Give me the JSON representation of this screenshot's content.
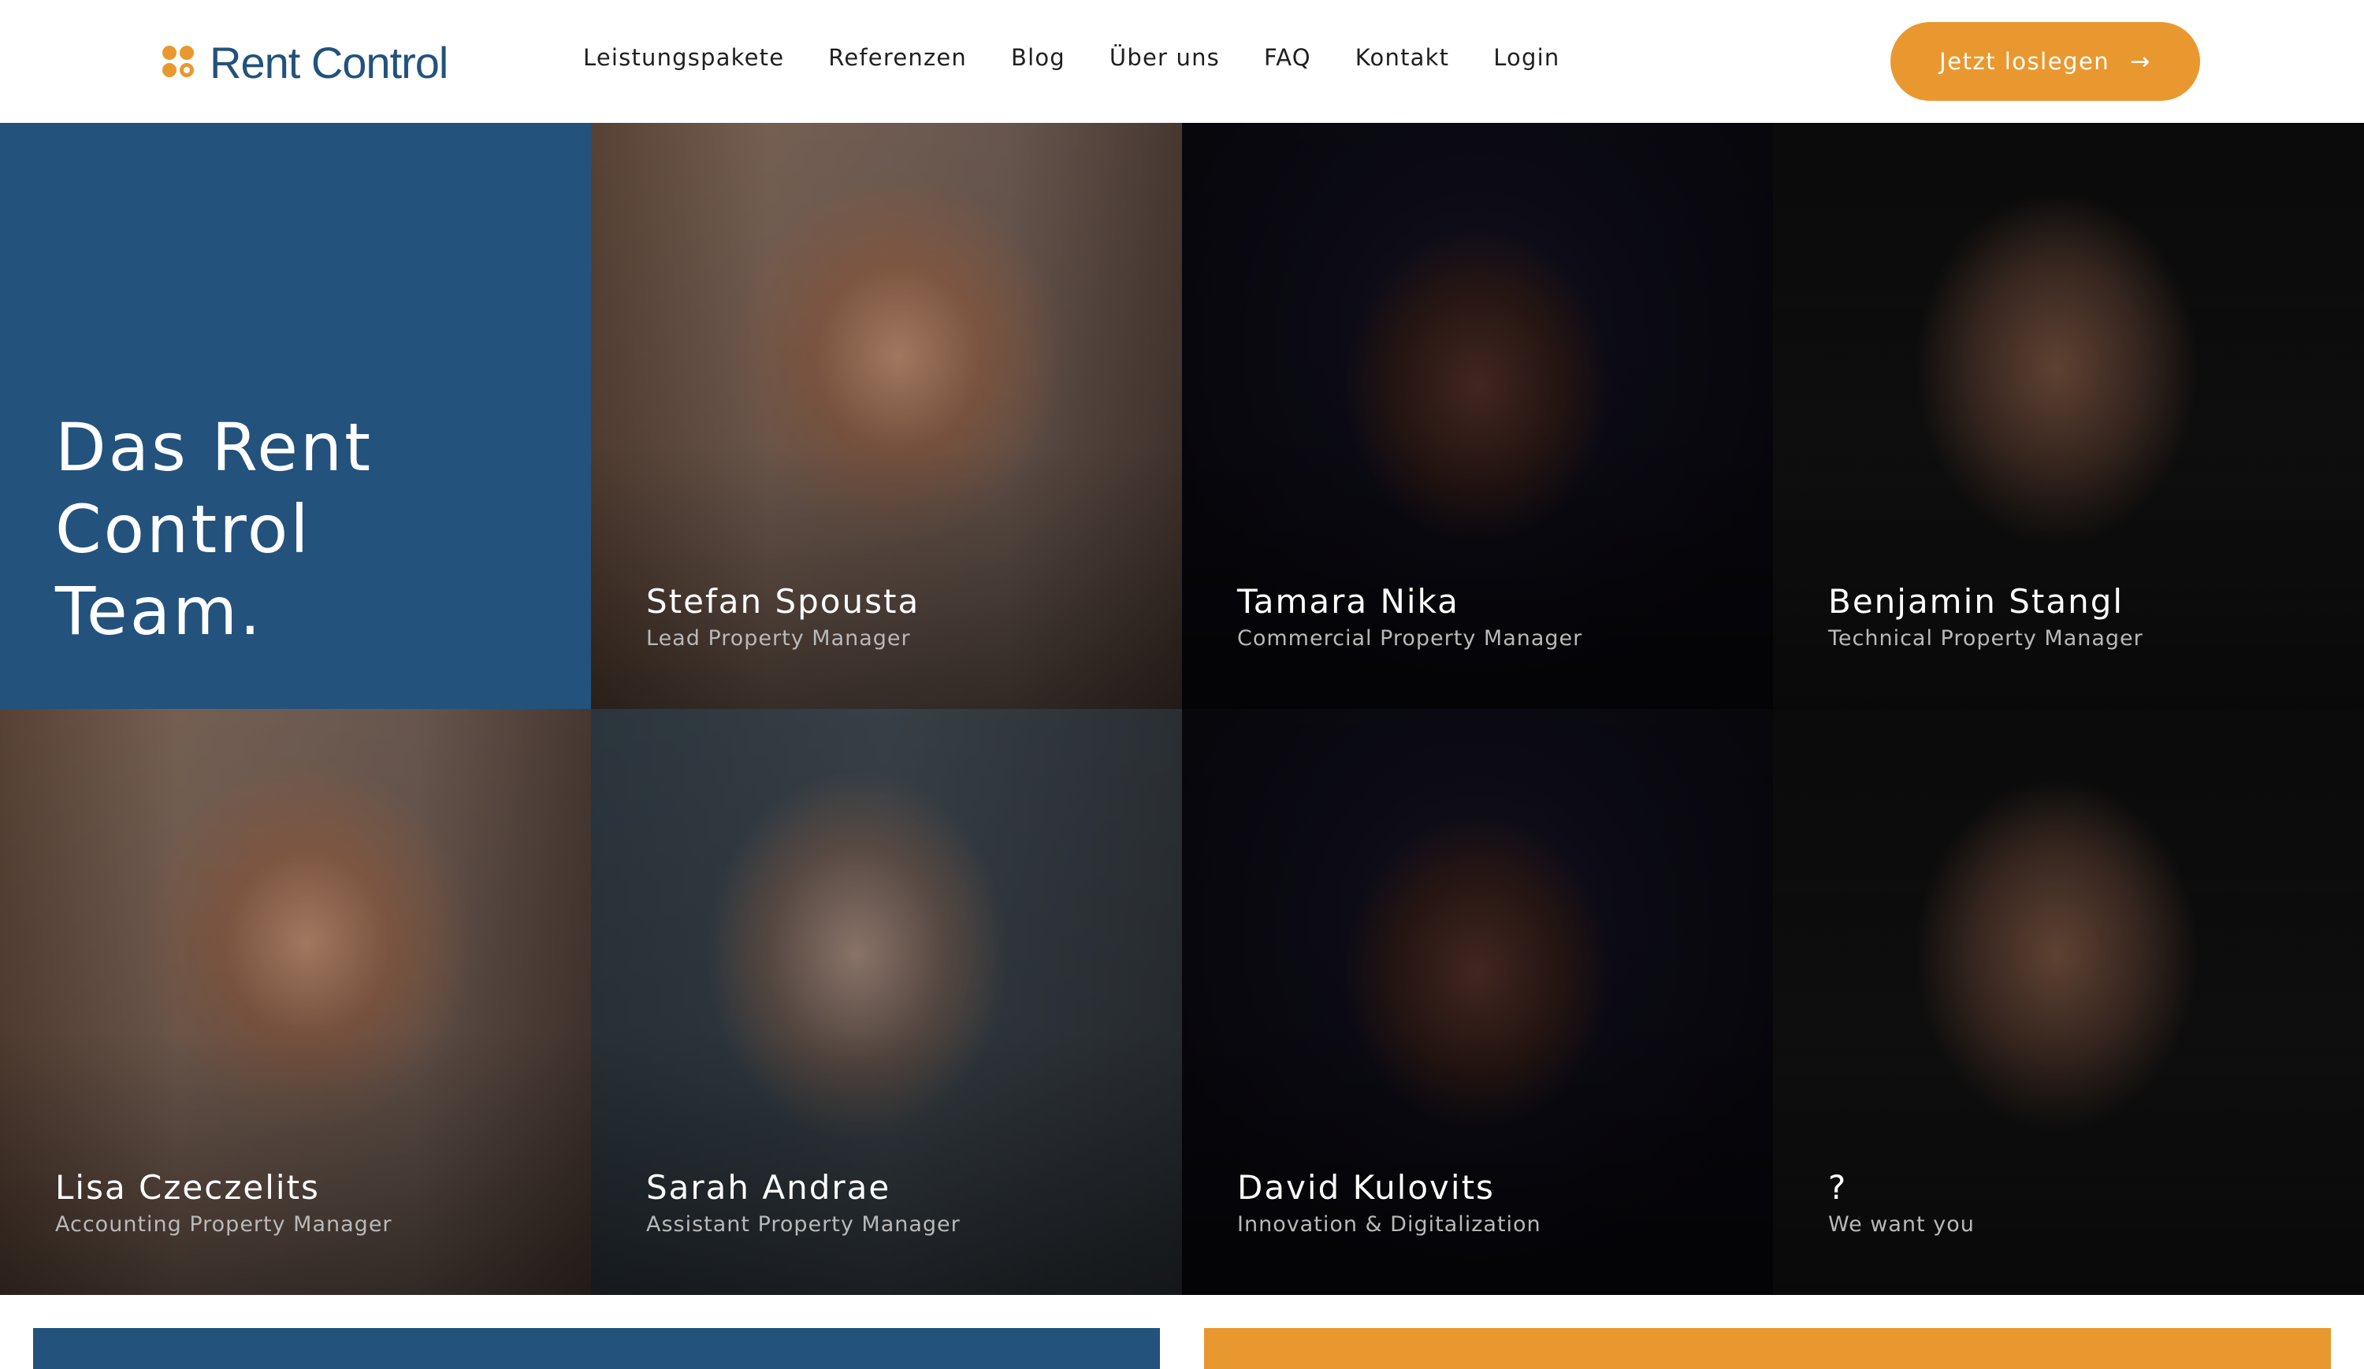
{
  "colors": {
    "brand_blue": "#23527c",
    "brand_orange": "#e9982f"
  },
  "header": {
    "logo_text": "Rent Control",
    "nav": [
      "Leistungspakete",
      "Referenzen",
      "Blog",
      "Über uns",
      "FAQ",
      "Kontakt",
      "Login"
    ],
    "cta_label": "Jetzt loslegen",
    "cta_icon": "arrow-right-icon"
  },
  "team": {
    "title": "Das Rent Control Team.",
    "members": [
      {
        "name": "Stefan Spousta",
        "role": "Lead Property Manager"
      },
      {
        "name": "Tamara Nika",
        "role": "Commercial Property Manager"
      },
      {
        "name": "Benjamin Stangl",
        "role": "Technical Property Manager"
      },
      {
        "name": "Lisa Czeczelits",
        "role": "Accounting Property Manager"
      },
      {
        "name": "Sarah Andrae",
        "role": "Assistant Property Manager"
      },
      {
        "name": "David Kulovits",
        "role": "Innovation & Digitalization"
      },
      {
        "name": "?",
        "role": "We want you"
      }
    ]
  }
}
